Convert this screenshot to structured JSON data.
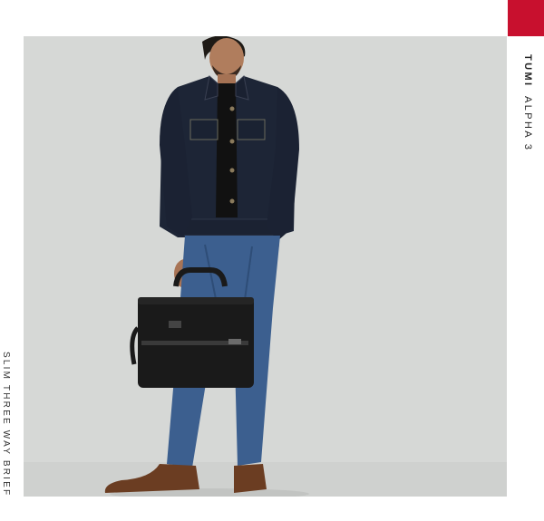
{
  "brand": {
    "name": "TUMI",
    "line": "ALPHA 3",
    "accent_color": "#c8102e"
  },
  "product": {
    "name": "SLIM THREE WAY BRIEF"
  },
  "photo": {
    "background_color": "#d6d8d6"
  }
}
